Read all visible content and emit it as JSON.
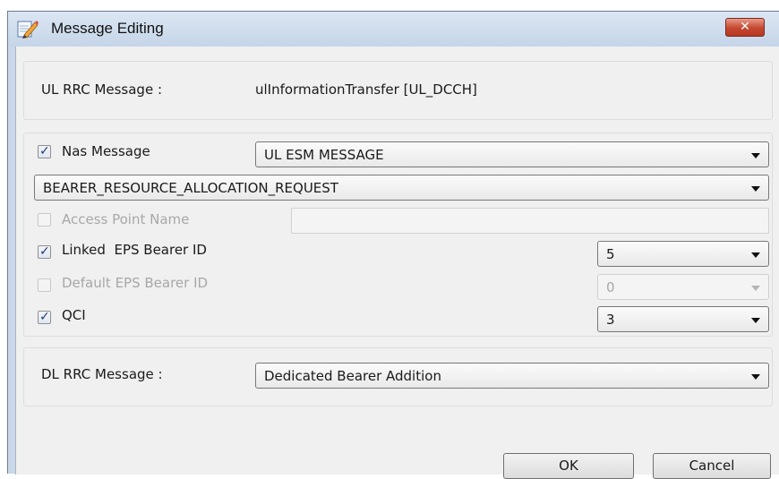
{
  "window": {
    "title": "Message Editing",
    "close_glyph": "✕",
    "title_icon": "pencil-edit-icon"
  },
  "ul_rrc": {
    "label": "UL RRC Message :",
    "value": "ulInformationTransfer [UL_DCCH]"
  },
  "nas": {
    "checkbox_label": "Nas Message",
    "checked": true,
    "message_type": "UL ESM MESSAGE",
    "procedure": "BEARER_RESOURCE_ALLOCATION_REQUEST",
    "fields": [
      {
        "label": "Access Point Name",
        "checked": false,
        "enabled": false,
        "value": ""
      },
      {
        "label": "Linked  EPS Bearer ID",
        "checked": true,
        "enabled": true,
        "value": "5"
      },
      {
        "label": "Default EPS Bearer ID",
        "checked": false,
        "enabled": false,
        "value": "0"
      },
      {
        "label": "QCI",
        "checked": true,
        "enabled": true,
        "value": "3"
      }
    ]
  },
  "dl_rrc": {
    "label": "DL RRC Message :",
    "value": "Dedicated Bearer Addition"
  },
  "buttons": {
    "ok": "OK",
    "cancel": "Cancel"
  },
  "checkmark_glyph": "✓"
}
